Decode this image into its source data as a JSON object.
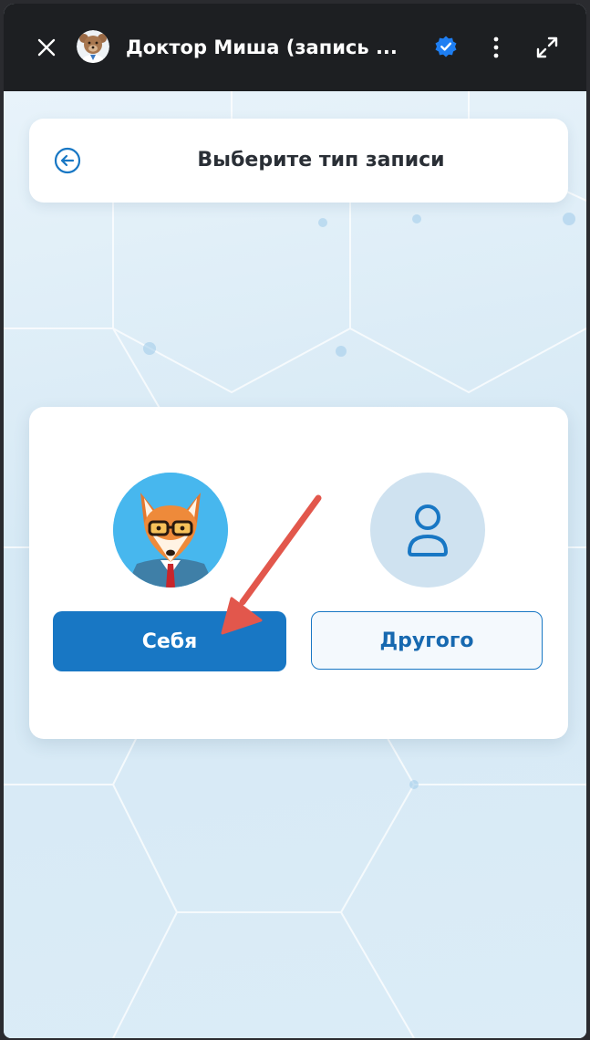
{
  "topbar": {
    "title": "Доктор Миша (запись ...",
    "icons": {
      "close": "close-icon",
      "avatar": "bear-doctor-avatar",
      "verified": "verified-badge-icon",
      "menu": "more-vertical-icon",
      "expand": "expand-icon"
    },
    "verified_color": "#1e7ef2"
  },
  "header": {
    "title": "Выберите тип записи",
    "back_icon": "arrow-left-circle-icon"
  },
  "choices": {
    "self": {
      "label": "Себя",
      "avatar_icon": "fox-avatar"
    },
    "other": {
      "label": "Другого",
      "avatar_icon": "user-icon"
    }
  },
  "colors": {
    "accent": "#1877c4",
    "topbar_bg": "#1d1f22",
    "background": "#dcebf6",
    "annotation_arrow": "#e2574c"
  }
}
